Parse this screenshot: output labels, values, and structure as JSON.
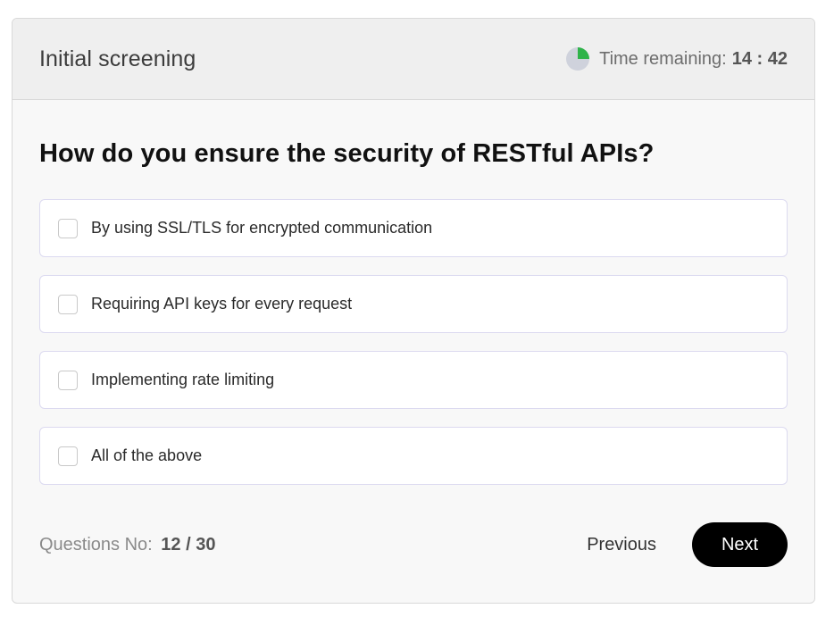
{
  "header": {
    "title": "Initial screening",
    "timer_label": "Time remaining:",
    "timer_value": "14 : 42",
    "timer_progress": 0.25,
    "colors": {
      "pie_fill": "#2fb34a",
      "pie_bg": "#cfd2dc"
    }
  },
  "question": {
    "text": "How do you ensure the security of RESTful APIs?",
    "options": [
      {
        "label": "By using SSL/TLS for encrypted communication",
        "checked": false
      },
      {
        "label": "Requiring API keys for every request",
        "checked": false
      },
      {
        "label": "Implementing rate limiting",
        "checked": false
      },
      {
        "label": "All of the above",
        "checked": false
      }
    ]
  },
  "footer": {
    "count_label": "Questions No:",
    "count_value": "12 / 30",
    "previous_label": "Previous",
    "next_label": "Next"
  }
}
